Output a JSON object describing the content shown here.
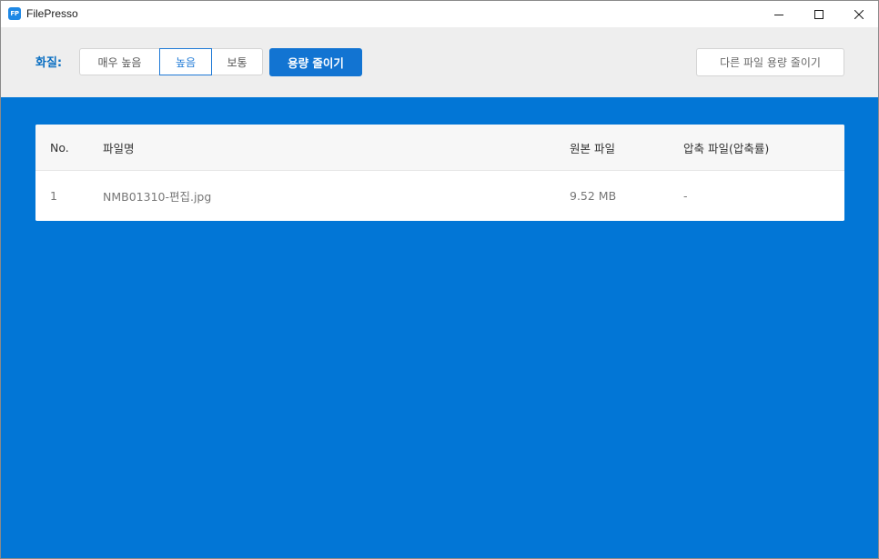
{
  "window": {
    "app_icon_text": "FP",
    "title": "FilePresso"
  },
  "toolbar": {
    "quality_label": "화질:",
    "quality_options": [
      "매우 높음",
      "높음",
      "보통"
    ],
    "selected_quality": "높음",
    "compress_button": "용량 줄이기",
    "other_file_button": "다른 파일 용량 줄이기"
  },
  "table": {
    "headers": {
      "no": "No.",
      "name": "파일명",
      "original": "원본 파일",
      "compressed": "압축 파일(압축률)"
    },
    "rows": [
      {
        "no": "1",
        "name": "NMB01310-편집.jpg",
        "original": "9.52 MB",
        "compressed": "-"
      }
    ]
  },
  "colors": {
    "background_blue": "#0276d6",
    "accent_blue": "#1274d2",
    "toolbar_gray": "#eeeeee"
  }
}
